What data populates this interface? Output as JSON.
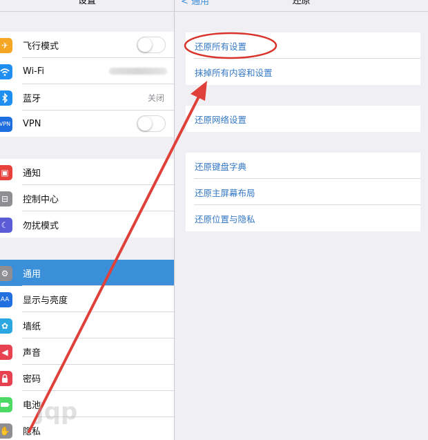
{
  "left_nav": {
    "title": "设置"
  },
  "right_nav": {
    "back_label": "通用",
    "title": "还原"
  },
  "settings_groups": [
    [
      {
        "label": "飞行模式",
        "icon": "airplane-icon",
        "color": "#f5a623",
        "accessory": "toggle"
      },
      {
        "label": "Wi-Fi",
        "icon": "wifi-icon",
        "color": "#1f8ef1",
        "accessory": "blurred-value"
      },
      {
        "label": "蓝牙",
        "icon": "bluetooth-icon",
        "color": "#1f8ef1",
        "accessory": "detail",
        "detail": "关闭"
      },
      {
        "label": "VPN",
        "icon": "vpn-icon",
        "color": "#1f6fe0",
        "accessory": "toggle"
      }
    ],
    [
      {
        "label": "通知",
        "icon": "notifications-icon",
        "color": "#e8413b"
      },
      {
        "label": "控制中心",
        "icon": "control-center-icon",
        "color": "#8e8e93"
      },
      {
        "label": "勿扰模式",
        "icon": "moon-icon",
        "color": "#5b5bd6"
      }
    ],
    [
      {
        "label": "通用",
        "icon": "gear-icon",
        "color": "#8e8e93",
        "selected": true
      },
      {
        "label": "显示与亮度",
        "icon": "display-icon",
        "color": "#1f6fe0"
      },
      {
        "label": "墙纸",
        "icon": "wallpaper-icon",
        "color": "#2aa7e0"
      },
      {
        "label": "声音",
        "icon": "sound-icon",
        "color": "#e8414f"
      },
      {
        "label": "密码",
        "icon": "lock-icon",
        "color": "#e8414f"
      },
      {
        "label": "电池",
        "icon": "battery-icon",
        "color": "#4cd964"
      },
      {
        "label": "隐私",
        "icon": "hand-icon",
        "color": "#8e8e93"
      }
    ]
  ],
  "reset_groups": [
    [
      "还原所有设置",
      "抹掉所有内容和设置"
    ],
    [
      "还原网络设置"
    ],
    [
      "还原键盘字典",
      "还原主屏幕布局",
      "还原位置与隐私"
    ]
  ],
  "annotation": {
    "ellipse_color": "#d9342b",
    "arrow_color": "#e0403a"
  },
  "colors": {
    "accent": "#3b8fd9",
    "link": "#3478c6",
    "background": "#efeff4"
  }
}
